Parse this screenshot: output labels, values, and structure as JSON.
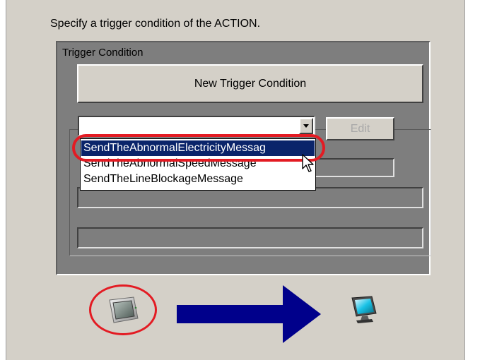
{
  "instruction": "Specify a trigger condition of the ACTION.",
  "trigger_group": {
    "title": "Trigger Condition",
    "new_button_label": "New Trigger Condition",
    "edit_button_label": "Edit",
    "combo_value": "",
    "dropdown_options": [
      "SendTheAbnormalElectricityMessag",
      "SendTheAbnormalSpeedMessage",
      "SendTheLineBlockageMessage"
    ],
    "selected_index": 0
  },
  "colors": {
    "highlight": "#e31b23",
    "selection": "#0a246a",
    "arrow": "#00008b"
  },
  "icons": {
    "source": "display-device-icon",
    "target": "computer-monitor-icon"
  }
}
